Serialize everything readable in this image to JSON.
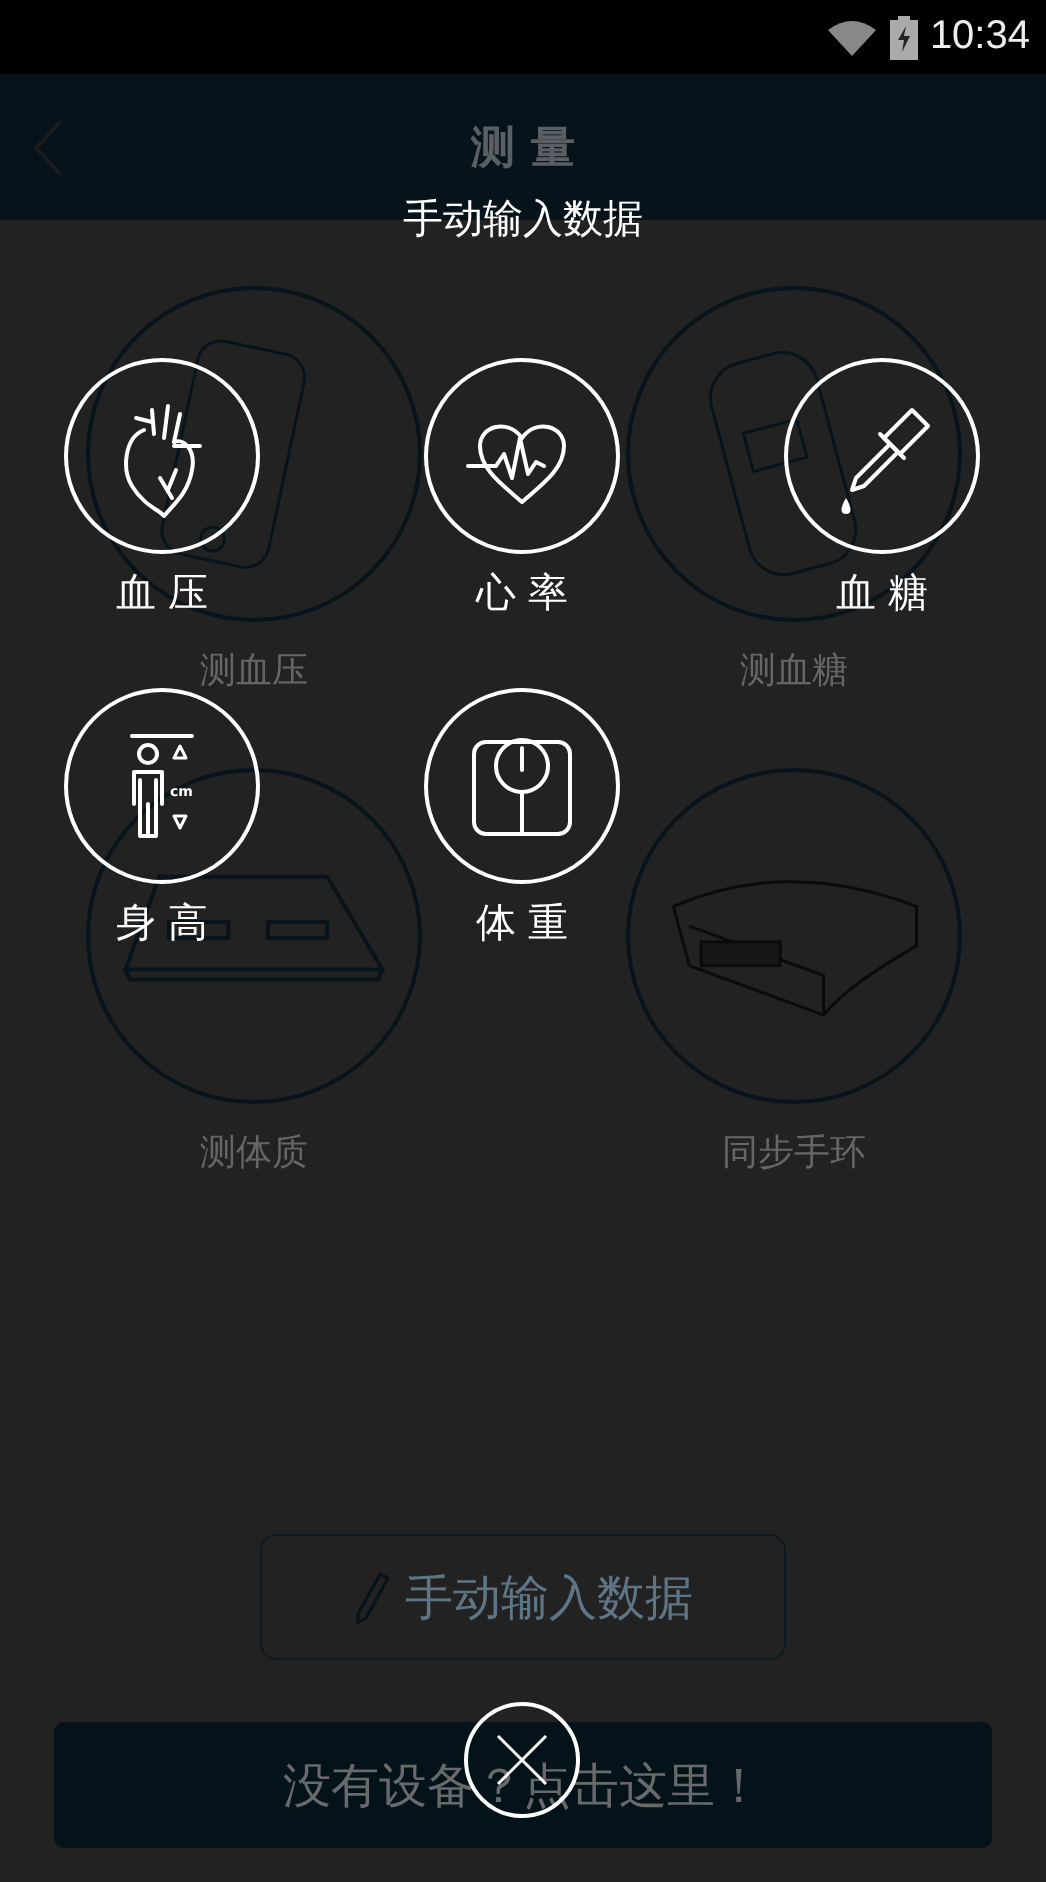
{
  "status_bar": {
    "time": "10:34"
  },
  "header": {
    "title": "测 量"
  },
  "devices": [
    {
      "kind": "bp_monitor",
      "label": "测血压"
    },
    {
      "kind": "glucose_meter",
      "label": "测血糖"
    },
    {
      "kind": "body_scale",
      "label": "测体质"
    },
    {
      "kind": "wristband",
      "label": "同步手环"
    }
  ],
  "manual_button": {
    "label": "手动输入数据"
  },
  "no_device_button": {
    "label": "没有设备？点击这里！"
  },
  "overlay": {
    "title": "手动输入数据",
    "options": [
      {
        "kind": "heart",
        "label": "血 压"
      },
      {
        "kind": "heartbeat",
        "label": "心 率"
      },
      {
        "kind": "dropper",
        "label": "血 糖"
      },
      {
        "kind": "height",
        "label": "身 高",
        "icon_text": "cm"
      },
      {
        "kind": "scale",
        "label": "体 重"
      }
    ]
  }
}
